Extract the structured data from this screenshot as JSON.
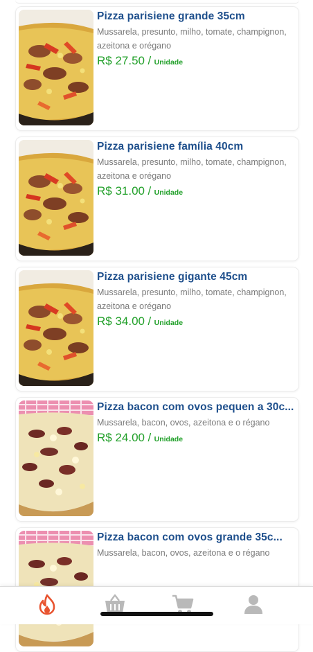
{
  "products": [
    {
      "title": "Pizza parisiene grande 35cm",
      "description": "Mussarela, presunto, milho, tomate, champignon, azeitona e orégano",
      "price": "R$ 27.50",
      "separator": "/",
      "unit": "Unidade",
      "image": "pizza-parisiene"
    },
    {
      "title": "Pizza parisiene família 40cm",
      "description": "Mussarela, presunto, milho, tomate, champignon, azeitona e orégano",
      "price": "R$ 31.00",
      "separator": "/",
      "unit": "Unidade",
      "image": "pizza-parisiene"
    },
    {
      "title": "Pizza parisiene gigante 45cm",
      "description": "Mussarela, presunto, milho, tomate, champignon, azeitona e orégano",
      "price": "R$ 34.00",
      "separator": "/",
      "unit": "Unidade",
      "image": "pizza-parisiene"
    },
    {
      "title": "Pizza bacon com ovos pequen a 30c...",
      "description": "Mussarela, bacon, ovos, azeitona e o régano",
      "price": "R$ 24.00",
      "separator": "/",
      "unit": "Unidade",
      "image": "pizza-bacon"
    },
    {
      "title": "Pizza bacon com ovos grande 35c...",
      "description": "Mussarela, bacon, ovos, azeitona e o régano",
      "price": "",
      "separator": "",
      "unit": "",
      "image": "pizza-bacon"
    }
  ],
  "tabbar": {
    "tabs": [
      {
        "icon": "fire-icon",
        "active": true
      },
      {
        "icon": "basket-icon",
        "active": false
      },
      {
        "icon": "cart-icon",
        "active": false
      },
      {
        "icon": "user-icon",
        "active": false
      }
    ],
    "active_color": "#e8532f",
    "inactive_color": "#b9b9b9"
  },
  "colors": {
    "title": "#1e4f8c",
    "description": "#7b7b7b",
    "price": "#22a02a"
  }
}
